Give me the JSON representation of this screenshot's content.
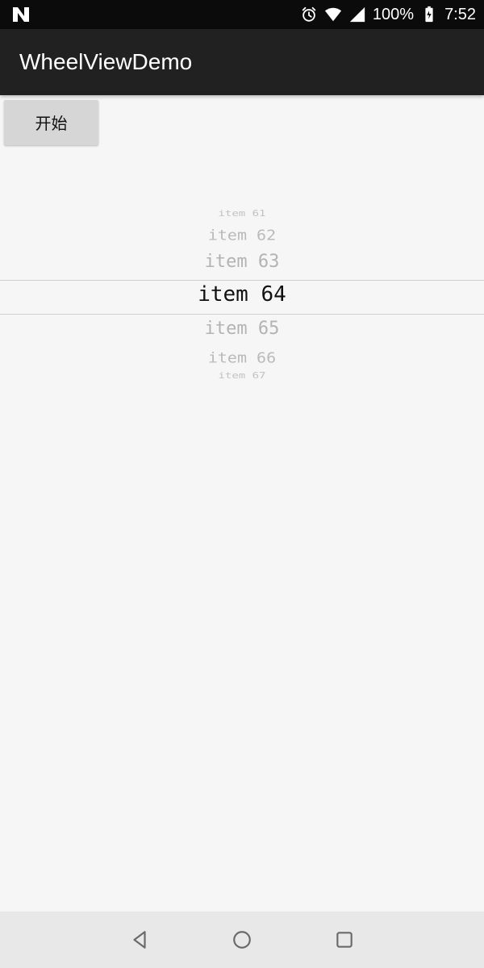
{
  "status_bar": {
    "battery_percent": "100%",
    "time": "7:52"
  },
  "app_bar": {
    "title": "WheelViewDemo"
  },
  "content": {
    "start_button_label": "开始"
  },
  "wheel": {
    "items": [
      "item 61",
      "item 62",
      "item 63",
      "item 64",
      "item 65",
      "item 66",
      "item 67"
    ],
    "selected_index": 3
  },
  "colors": {
    "status_bar_bg": "#0b0b0b",
    "app_bar_bg": "#212121",
    "content_bg": "#f6f6f7",
    "button_bg": "#d6d6d6",
    "wheel_unselected": "#b0b0b0",
    "wheel_selected": "#111111",
    "navbar_bg": "#e8e8e8"
  },
  "icons": {
    "status_left": "n-notification-icon",
    "alarm": "alarm-icon",
    "wifi": "wifi-icon",
    "signal": "signal-icon",
    "battery": "battery-charging-icon",
    "nav_back": "back-icon",
    "nav_home": "home-icon",
    "nav_recents": "recents-icon"
  }
}
